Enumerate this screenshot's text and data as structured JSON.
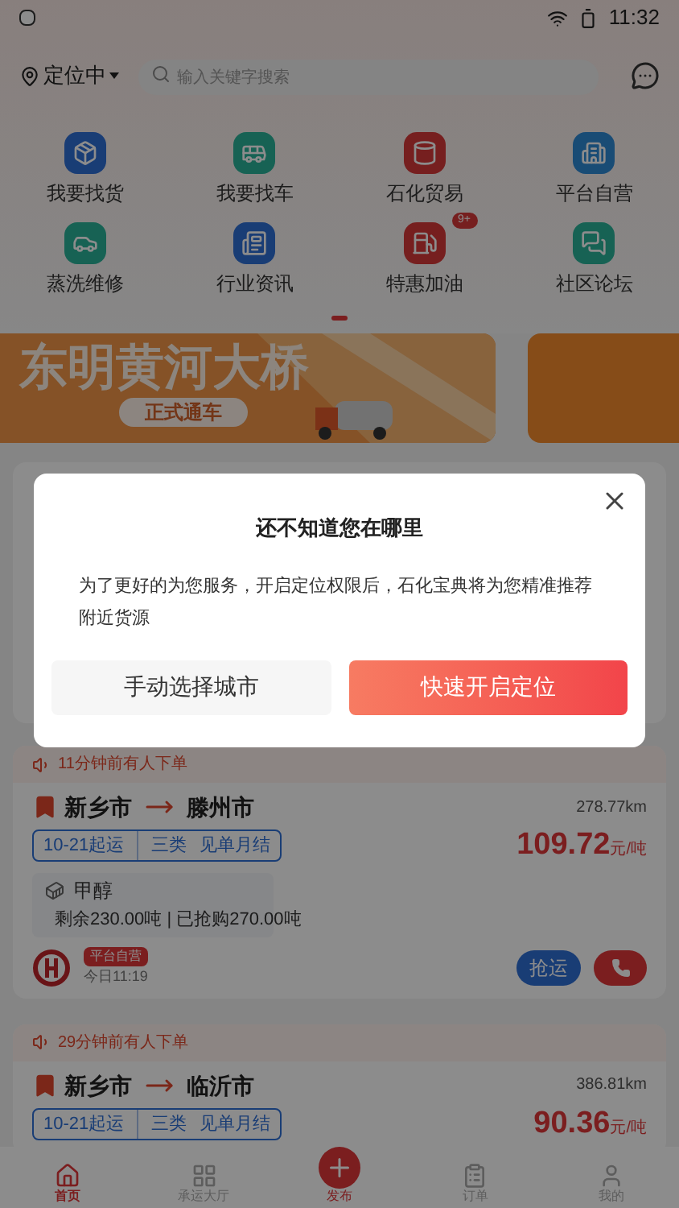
{
  "status_bar": {
    "time": "11:32"
  },
  "header": {
    "location": "定位中",
    "search": {
      "placeholder": "输入关键字搜索"
    }
  },
  "shortcuts": [
    {
      "label": "我要找货",
      "kind": "box"
    },
    {
      "label": "我要找车",
      "kind": "truck"
    },
    {
      "label": "石化贸易",
      "kind": "barrel"
    },
    {
      "label": "平台自营",
      "kind": "building"
    },
    {
      "label": "蒸洗维修",
      "kind": "car"
    },
    {
      "label": "行业资讯",
      "kind": "news"
    },
    {
      "label": "特惠加油",
      "kind": "fuel",
      "badge": "9+"
    },
    {
      "label": "社区论坛",
      "kind": "chat"
    }
  ],
  "banner": {
    "title": "东明黄河大桥",
    "subtitle": "正式通车"
  },
  "orders": [
    {
      "notice": "11分钟前有人下单",
      "from": "新乡市",
      "to": "滕州市",
      "distance": "278.77km",
      "tags": [
        "10-21起运",
        "三类",
        "见单月结"
      ],
      "price": "109.72",
      "unit": "元/吨",
      "cargo": "甲醇",
      "remaining": "剩余230.00吨 | 已抢购270.00吨",
      "badge": "平台自营",
      "time": "今日11:19",
      "action": "抢运"
    },
    {
      "notice": "29分钟前有人下单",
      "from": "新乡市",
      "to": "临沂市",
      "distance": "386.81km",
      "tags": [
        "10-21起运",
        "三类",
        "见单月结"
      ],
      "price": "90.36",
      "unit": "元/吨"
    }
  ],
  "bottom_nav": [
    {
      "label": "首页",
      "kind": "home",
      "selected": true
    },
    {
      "label": "承运大厅",
      "kind": "grid",
      "selected": false
    },
    {
      "label": "发布",
      "kind": "plus",
      "selected": false
    },
    {
      "label": "订单",
      "kind": "list",
      "selected": false
    },
    {
      "label": "我的",
      "kind": "user",
      "selected": false
    }
  ],
  "dialog": {
    "title": "还不知道您在哪里",
    "message": "为了更好的为您服务，开启定位权限后，石化宝典将为您精准推荐附近货源",
    "buttons": [
      {
        "label": "手动选择城市",
        "kind": "secondary"
      },
      {
        "label": "快速开启定位",
        "kind": "primary"
      }
    ]
  }
}
